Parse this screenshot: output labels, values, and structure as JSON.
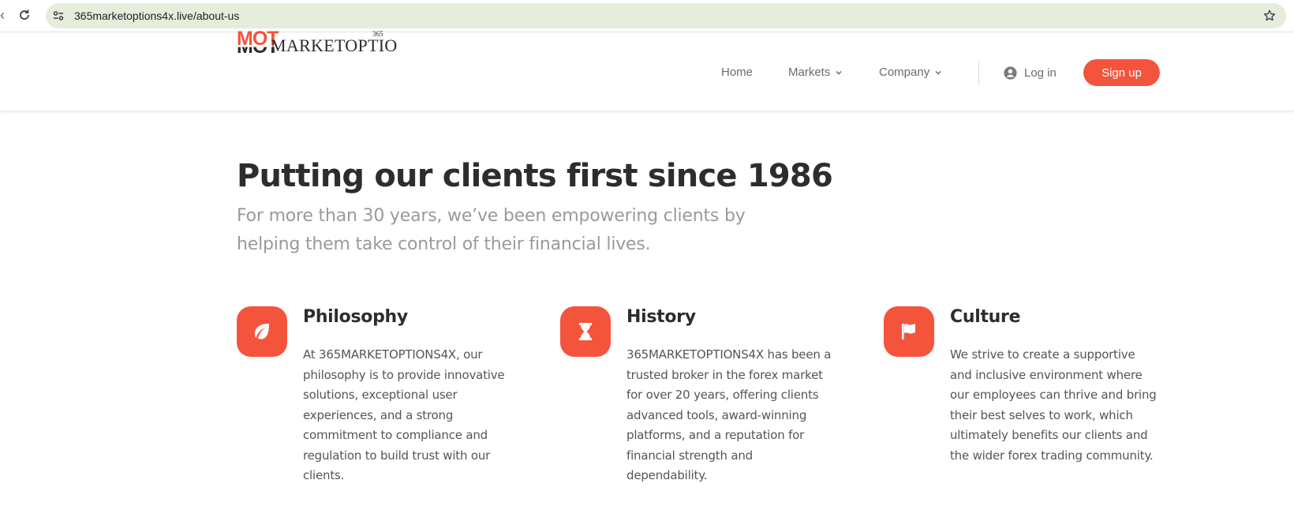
{
  "browser": {
    "url": "365marketoptions4x.live/about-us"
  },
  "header": {
    "logo": {
      "mark": "MOT",
      "wordmark": "MARKETOPTIO",
      "superscript": "365"
    },
    "nav": {
      "home": "Home",
      "markets": "Markets",
      "company": "Company",
      "login": "Log in",
      "signup": "Sign up"
    }
  },
  "hero": {
    "title_main": "Putting our clients first ",
    "title_highlight": "since 1986",
    "subtitle": "For more than 30 years, we’ve been empowering clients by helping them take control of their financial lives."
  },
  "features": [
    {
      "icon": "leaf-icon",
      "title": "Philosophy",
      "text": "At 365MARKETOPTIONS4X, our philosophy is to provide innovative solutions, exceptional user experiences, and a strong commitment to compliance and regulation to build trust with our clients."
    },
    {
      "icon": "hourglass-icon",
      "title": "History",
      "text": "365MARKETOPTIONS4X has been a trusted broker in the forex market for over 20 years, offering clients advanced tools, award-winning platforms, and a reputation for financial strength and dependability."
    },
    {
      "icon": "flag-icon",
      "title": "Culture",
      "text": "We strive to create a supportive and inclusive environment where our employees can thrive and bring their best selves to work, which ultimately benefits our clients and the wider forex trading community."
    }
  ],
  "colors": {
    "accent": "#f5543c",
    "highlight": "#f1bcb4",
    "omnibox": "#e7eddc"
  }
}
